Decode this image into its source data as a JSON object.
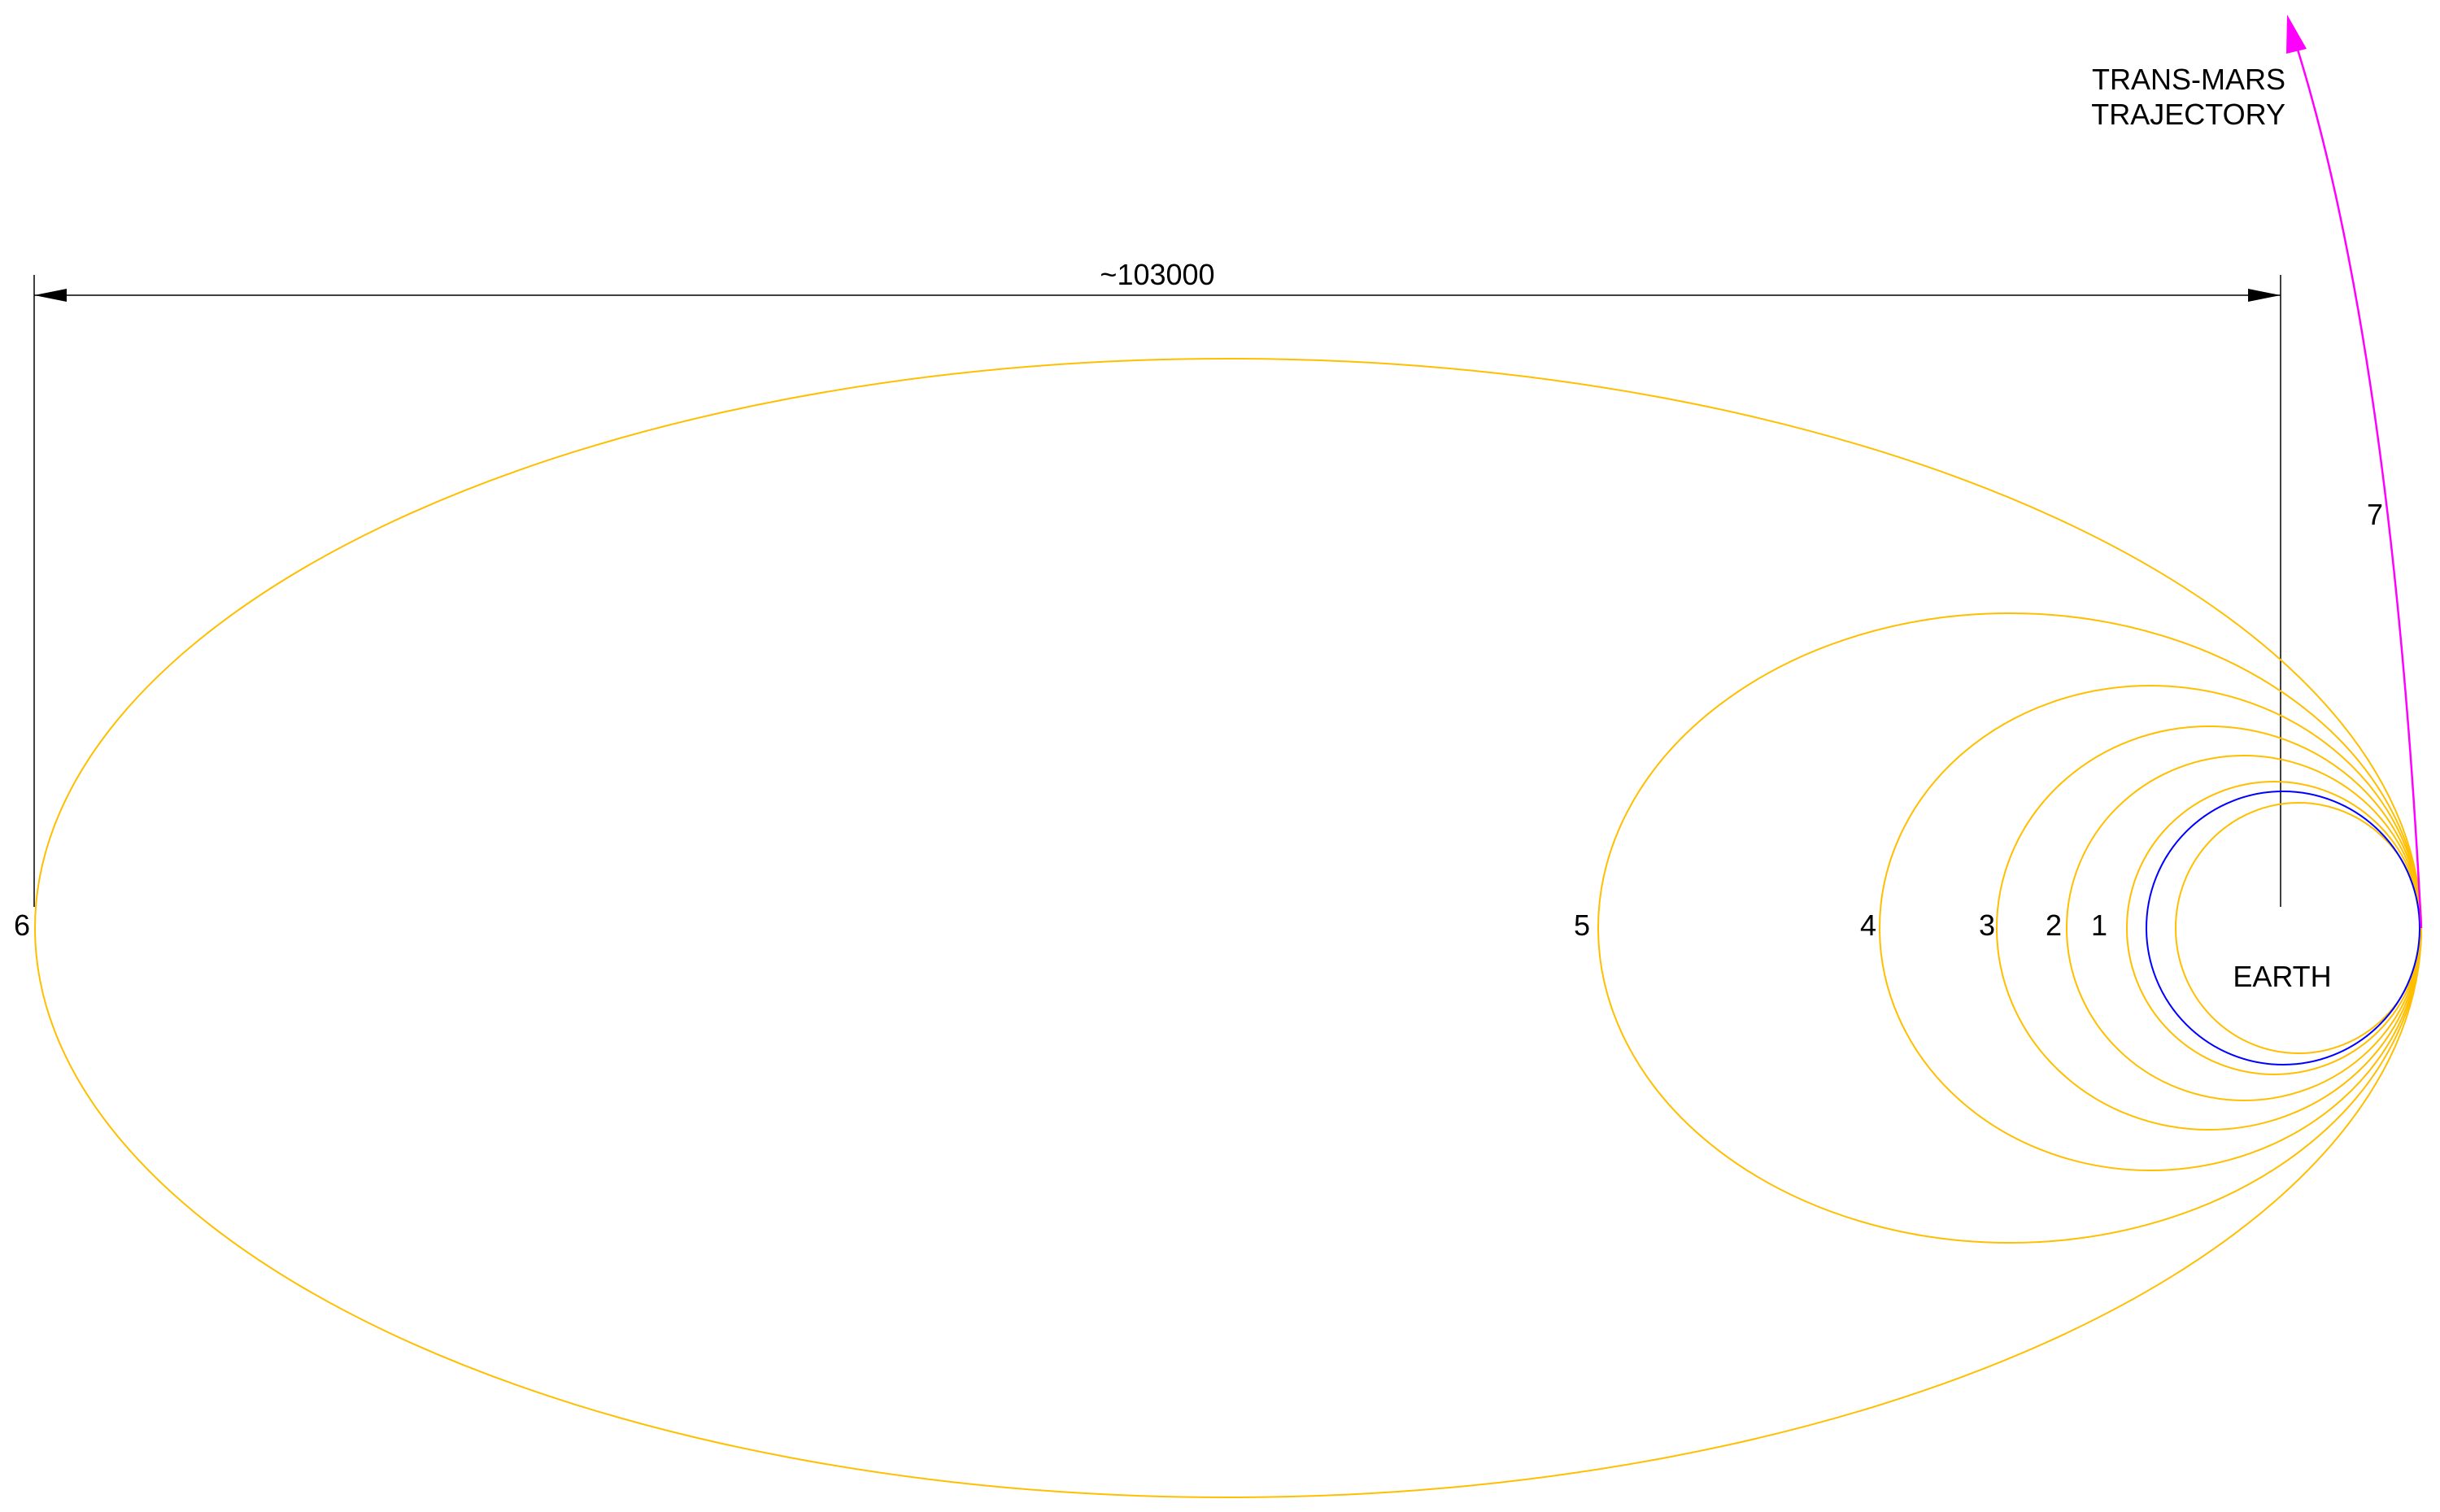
{
  "colors": {
    "orbit": "#FFBF00",
    "earth": "#0000FF",
    "trajectory": "#FF00FF",
    "dimension": "#000000",
    "background": "#FFFFFF"
  },
  "labels": {
    "dimension": "~103000",
    "trajectory_line1": "TRANS-MARS",
    "trajectory_line2": "TRAJECTORY",
    "earth": "EARTH",
    "orbit_1": "1",
    "orbit_2": "2",
    "orbit_3": "3",
    "orbit_4": "4",
    "orbit_5": "5",
    "orbit_6": "6",
    "orbit_7": "7"
  }
}
